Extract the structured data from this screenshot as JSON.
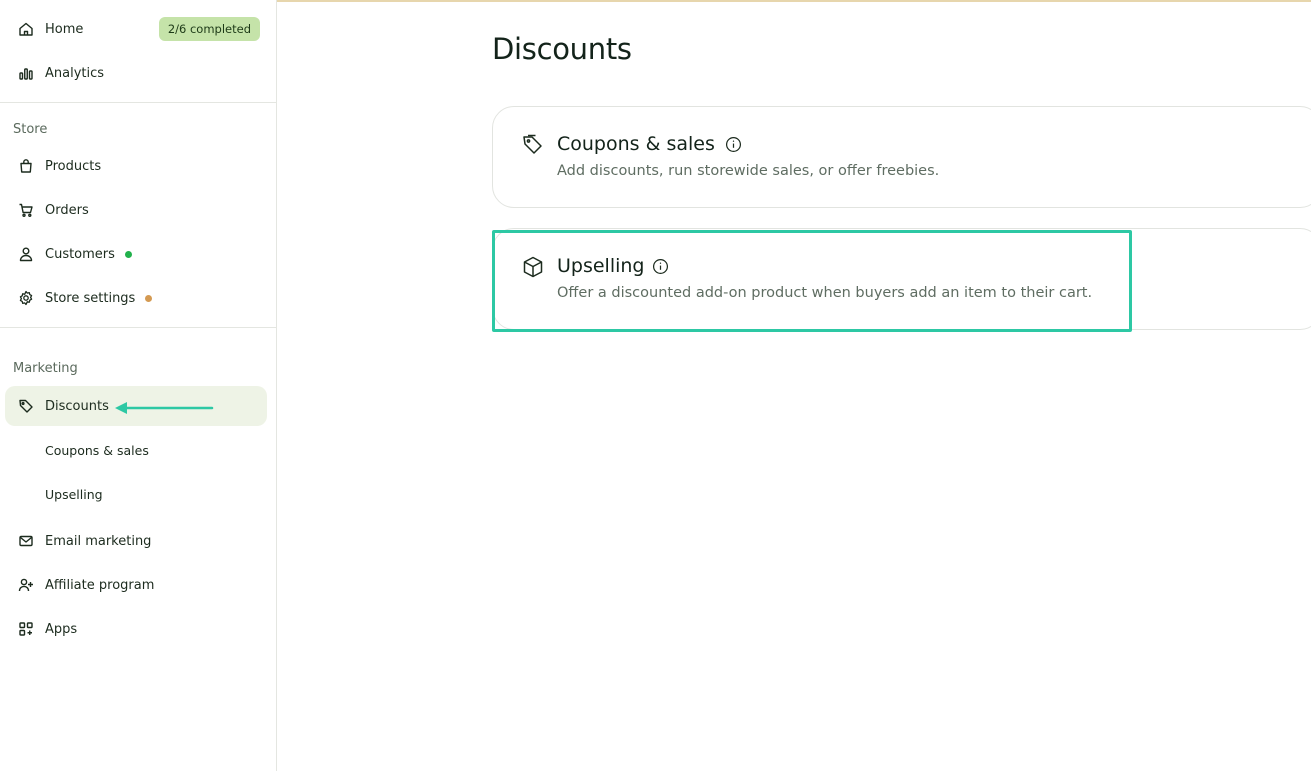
{
  "sidebar": {
    "home": {
      "label": "Home",
      "badge": "2/6 completed"
    },
    "analytics": {
      "label": "Analytics"
    },
    "store_section": "Store",
    "products": {
      "label": "Products"
    },
    "orders": {
      "label": "Orders"
    },
    "customers": {
      "label": "Customers",
      "dot_color": "#22b14c"
    },
    "store_settings": {
      "label": "Store settings",
      "dot_color": "#d49a52"
    },
    "marketing_section": "Marketing",
    "discounts": {
      "label": "Discounts"
    },
    "coupons_sales": {
      "label": "Coupons & sales"
    },
    "upselling": {
      "label": "Upselling"
    },
    "email_marketing": {
      "label": "Email marketing"
    },
    "affiliate_program": {
      "label": "Affiliate program"
    },
    "apps": {
      "label": "Apps"
    }
  },
  "main": {
    "title": "Discounts",
    "cards": [
      {
        "title": "Coupons & sales",
        "description": "Add discounts, run storewide sales, or offer freebies.",
        "icon": "tag-icon"
      },
      {
        "title": "Upselling",
        "description": "Offer a discounted add-on product when buyers add an item to their cart.",
        "icon": "box-icon"
      }
    ]
  },
  "colors": {
    "accent_highlight": "#2dc8a4",
    "active_bg": "#eef3e6",
    "badge_bg": "#c5e3a9",
    "top_line": "#e7d6ad"
  }
}
